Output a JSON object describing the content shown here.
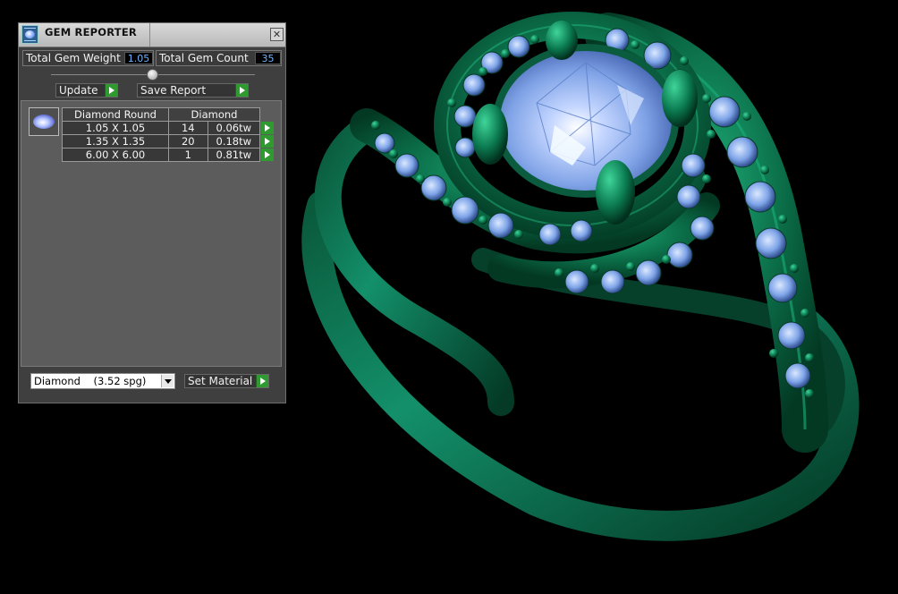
{
  "window": {
    "title": "GEM REPORTER",
    "close_symbol": "✕"
  },
  "stats": {
    "weight_label": "Total Gem Weight",
    "weight_value": "1.05",
    "count_label": "Total Gem Count",
    "count_value": "35"
  },
  "buttons": {
    "update": "Update",
    "save_report": "Save Report",
    "set_material": "Set Material"
  },
  "gem_table": {
    "header_shape": "Diamond Round",
    "header_material": "Diamond",
    "rows": [
      {
        "size": "1.05 X 1.05",
        "count": "14",
        "weight": "0.06tw"
      },
      {
        "size": "1.35 X 1.35",
        "count": "20",
        "weight": "0.18tw"
      },
      {
        "size": "6.00 X 6.00",
        "count": "1",
        "weight": "0.81tw"
      }
    ]
  },
  "material_select": {
    "value": "Diamond    (3.52 spg)"
  },
  "colors": {
    "metal": "#0e7a52",
    "gem": "#8fb3f0",
    "accent": "#2f9a2f",
    "value_text": "#6fb4ff"
  }
}
